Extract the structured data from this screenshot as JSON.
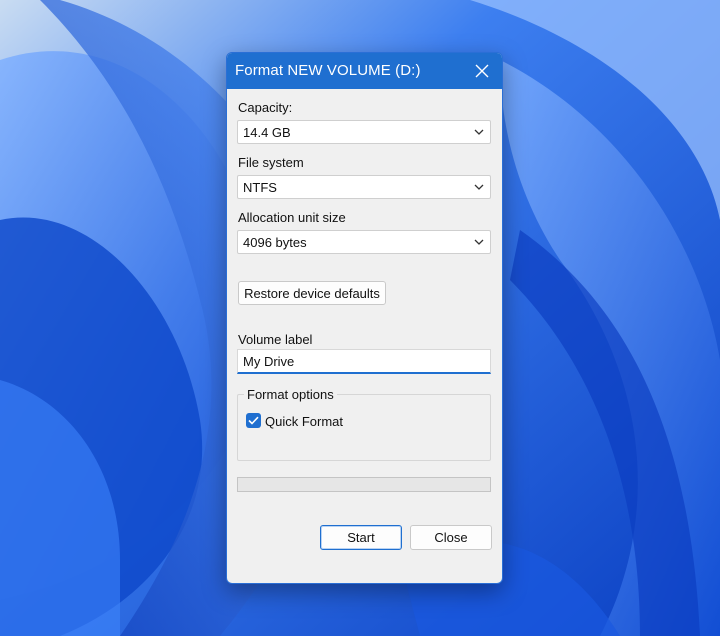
{
  "dialog": {
    "title": "Format NEW VOLUME (D:)",
    "close_icon": "close-icon"
  },
  "capacity": {
    "label": "Capacity:",
    "value": "14.4 GB"
  },
  "file_system": {
    "label": "File system",
    "value": "NTFS"
  },
  "allocation": {
    "label": "Allocation unit size",
    "value": "4096 bytes"
  },
  "restore_button": {
    "label": "Restore device defaults"
  },
  "volume_label": {
    "label": "Volume label",
    "value": "My Drive"
  },
  "format_options": {
    "legend": "Format options",
    "quick_format": {
      "label": "Quick Format",
      "checked": true
    }
  },
  "progress": {
    "value": 0
  },
  "buttons": {
    "start": "Start",
    "close": "Close"
  },
  "colors": {
    "accent": "#1f6fd0",
    "dialog_bg": "#f0f0f0",
    "wallpaper": "#2f6fe8"
  }
}
